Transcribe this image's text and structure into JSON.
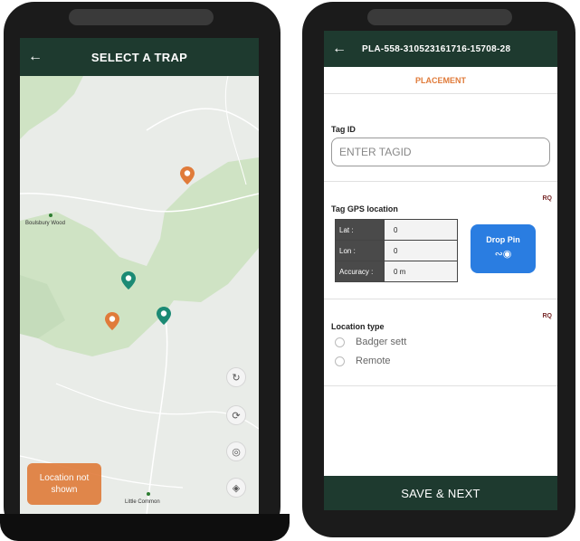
{
  "left_screen": {
    "title": "SELECT A TRAP",
    "map": {
      "places": [
        "Boulsbury Wood",
        "Little Common"
      ],
      "location_badge": "Location not shown",
      "controls": [
        "rotate-icon",
        "route-icon",
        "locate-icon",
        "layers-icon"
      ]
    }
  },
  "right_screen": {
    "title": "PLA-558-310523161716-15708-28",
    "tab": "PLACEMENT",
    "tag_id": {
      "label": "Tag ID",
      "placeholder": "ENTER TAGID",
      "value": ""
    },
    "gps": {
      "label": "Tag GPS location",
      "required": "RQ",
      "rows": [
        {
          "key": "Lat :",
          "value": "0"
        },
        {
          "key": "Lon :",
          "value": "0"
        },
        {
          "key": "Accuracy :",
          "value": "0 m"
        }
      ],
      "drop_pin_label": "Drop Pin"
    },
    "location_type": {
      "label": "Location type",
      "required": "RQ",
      "options": [
        "Badger sett",
        "Remote"
      ]
    },
    "save_label": "SAVE & NEXT"
  },
  "colors": {
    "appbar": "#1e3a2f",
    "accent_orange": "#e07b3a",
    "pin_teal": "#1b8a74",
    "drop_pin_blue": "#2a7de1",
    "map_green": "#cfe3c4"
  }
}
